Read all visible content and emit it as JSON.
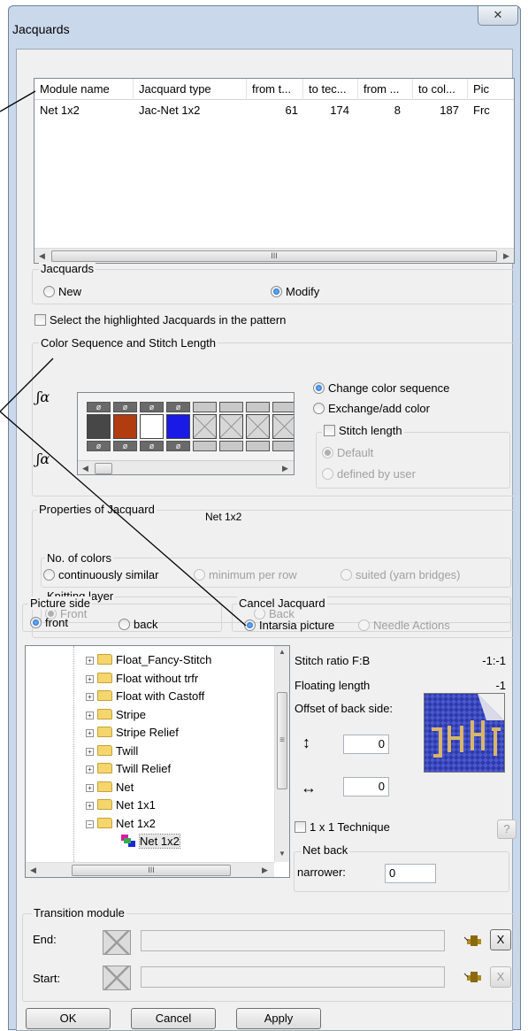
{
  "window": {
    "title": "Jacquards",
    "close_glyph": "✕"
  },
  "module_list": {
    "columns": [
      "Module name",
      "Jacquard type",
      "from t...",
      "to tec...",
      "from ...",
      "to col...",
      "Pic"
    ],
    "rows": [
      [
        "Net 1x2",
        "Jac-Net 1x2",
        "61",
        "174",
        "8",
        "187",
        "Frc"
      ]
    ],
    "scroll_thumb_grip": "III"
  },
  "jacquards_group": {
    "title": "Jacquards",
    "new_label": "New",
    "modify_label": "Modify",
    "selected": "modify"
  },
  "select_highlighted": {
    "label": "Select the highlighted Jacquards in the pattern",
    "checked": false
  },
  "color_sequence": {
    "title": "Color Sequence and Stitch Length",
    "symbol": "ø",
    "colors": [
      "#474747",
      "#b03c10",
      "#ffffff",
      "#1a1ae6"
    ],
    "change_label": "Change color sequence",
    "exchange_label": "Exchange/add color",
    "selected": "change",
    "stitch_length": {
      "label": "Stitch length",
      "checked": false,
      "default_label": "Default",
      "user_label": "defined by user"
    }
  },
  "properties": {
    "title": "Properties of Jacquard",
    "name": "Net 1x2",
    "no_of_colors": {
      "title": "No. of colors",
      "continuous_label": "continuously similar",
      "minimum_label": "minimum per row",
      "suited_label": "suited (yarn bridges)"
    },
    "knitting_layer": {
      "title": "Knitting layer",
      "front_label": "Front",
      "back_label": "Back"
    },
    "picture_side": {
      "title": "Picture side",
      "front_label": "front",
      "back_label": "back"
    },
    "cancel_jacquard": {
      "title": "Cancel Jacquard",
      "intarsia_label": "Intarsia picture",
      "needle_label": "Needle Actions"
    }
  },
  "tree": {
    "items": [
      {
        "label": "Float_Fancy-Stitch",
        "expander": "+"
      },
      {
        "label": "Float without trfr",
        "expander": "+"
      },
      {
        "label": "Float with Castoff",
        "expander": "+"
      },
      {
        "label": "Stripe",
        "expander": "+"
      },
      {
        "label": "Stripe Relief",
        "expander": "+"
      },
      {
        "label": "Twill",
        "expander": "+"
      },
      {
        "label": "Twill Relief",
        "expander": "+"
      },
      {
        "label": "Net",
        "expander": "+"
      },
      {
        "label": "Net 1x1",
        "expander": "+"
      },
      {
        "label": "Net 1x2",
        "expander": "−"
      }
    ],
    "selected_leaf": "Net 1x2",
    "scroll_grip": "≡",
    "hscroll_grip": "III"
  },
  "stitch_info": {
    "ratio_label": "Stitch ratio F:B",
    "ratio_value": "-1:-1",
    "floating_label": "Floating length",
    "floating_value": "-1",
    "offset_label": "Offset of back side:",
    "vertical_icon": "↕",
    "vertical_value": "0",
    "horizontal_icon": "↔",
    "horizontal_value": "0",
    "technique_label": "1 x 1 Technique",
    "help_label": "?",
    "net_back_title": "Net back",
    "narrower_label": "narrower:",
    "narrower_value": "0"
  },
  "transition": {
    "title": "Transition module",
    "end_label": "End:",
    "start_label": "Start:",
    "x_label": "X"
  },
  "buttons": {
    "ok": "OK",
    "cancel": "Cancel",
    "apply": "Apply"
  },
  "colors": {
    "title_bar": "#c9d8ea",
    "dialog_bg": "#f0f0f0",
    "radio_selected": "#1560c0"
  }
}
